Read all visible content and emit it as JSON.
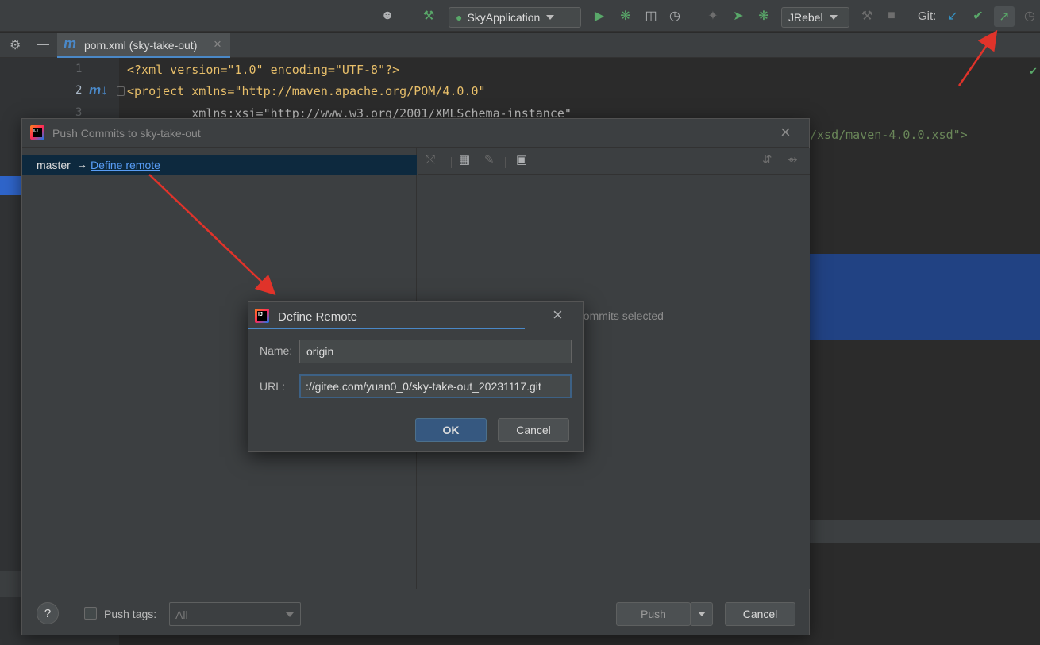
{
  "toolbar": {
    "run_config": "SkyApplication",
    "jrebel": "JRebel",
    "git_label": "Git:"
  },
  "tab": {
    "icon": "m",
    "label": "pom.xml (sky-take-out)",
    "close": "×"
  },
  "editor": {
    "lines": [
      {
        "num": "1",
        "text": "<?xml version=\"1.0\" encoding=\"UTF-8\"?>"
      },
      {
        "num": "2",
        "text": "<project xmlns=\"http://maven.apache.org/POM/4.0.0\""
      },
      {
        "num": "3",
        "text": "         xmlns:xsi=\"http://www.w3.org/2001/XMLSchema-instance\""
      }
    ],
    "line4_tail": "/xsd/maven-4.0.0.xsd\">"
  },
  "push_dialog": {
    "title": "Push Commits to sky-take-out",
    "branch": "master",
    "arrow": "→",
    "define_link": "Define remote",
    "no_commits": "No commits selected",
    "help": "?",
    "push_tags_label": "Push tags:",
    "tags_value": "All",
    "push_button": "Push",
    "cancel_button": "Cancel"
  },
  "remote_dialog": {
    "title": "Define Remote",
    "name_label": "Name:",
    "name_value": "origin",
    "url_label": "URL:",
    "url_value": "://gitee.com/yuan0_0/sky-take-out_20231117.git",
    "ok_button": "OK",
    "cancel_button": "Cancel"
  },
  "colors": {
    "accent": "#365880",
    "link": "#589df6",
    "annotation_arrow": "#e0332a"
  }
}
